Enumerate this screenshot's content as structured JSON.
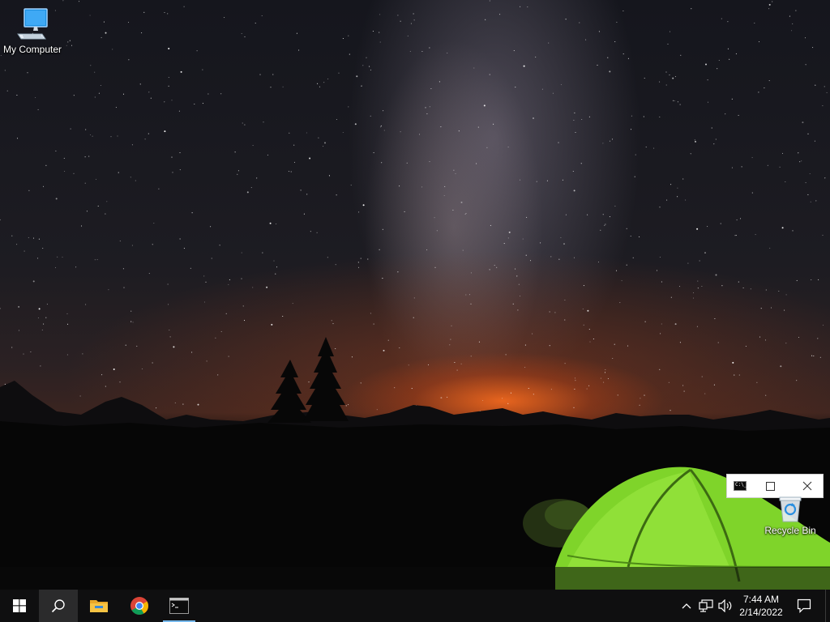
{
  "desktop": {
    "icons": [
      {
        "label": "My Computer",
        "icon": "computer-icon"
      },
      {
        "label": "Recycle Bin",
        "icon": "recycle-bin-icon"
      }
    ]
  },
  "mini_window": {
    "icon": "command-prompt-icon",
    "icon_text": "C:\\_",
    "buttons": {
      "maximize": "maximize-icon",
      "close": "close-icon"
    }
  },
  "taskbar": {
    "start": "windows-logo-icon",
    "search": "search-icon",
    "pinned": [
      {
        "name": "file-explorer",
        "icon": "folder-icon"
      },
      {
        "name": "chrome",
        "icon": "chrome-icon"
      },
      {
        "name": "command-prompt",
        "icon": "command-prompt-icon",
        "active": true
      }
    ],
    "tray": {
      "chevron": "chevron-up-icon",
      "network": "network-icon",
      "volume": "volume-icon",
      "action_center": "action-center-icon"
    },
    "clock": {
      "time": "7:44 AM",
      "date": "2/14/2022"
    }
  },
  "colors": {
    "taskbar": "#0f0f10",
    "active_underline": "#76b9ed",
    "tent": "#7fd42a"
  }
}
